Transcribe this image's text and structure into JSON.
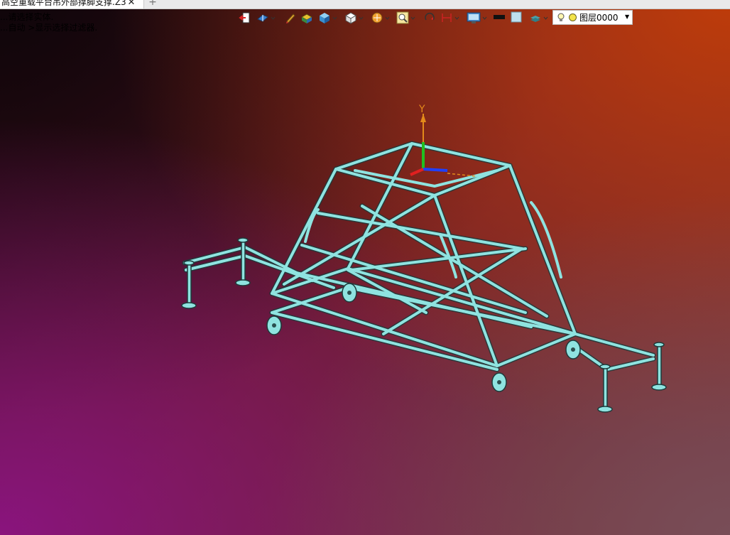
{
  "document_tab": {
    "title": "高空重载平台吊外部撑脚支撑.Z3",
    "close_symbol": "✕",
    "add_symbol": "+"
  },
  "status_lines": [
    "...请选择实体.",
    "...自动 >显示选择过滤器."
  ],
  "toolbar": {
    "icons": [
      {
        "name": "exit-icon",
        "has_dropdown": false
      },
      {
        "name": "view-orient-icon",
        "has_dropdown": true
      },
      {
        "name": "sketch-pen-icon",
        "has_dropdown": false
      },
      {
        "name": "shaded-solid-icon",
        "has_dropdown": false
      },
      {
        "name": "box-view-icon",
        "has_dropdown": true
      },
      {
        "name": "white-cube-icon",
        "has_dropdown": true
      },
      {
        "name": "render-style-icon",
        "has_dropdown": true
      },
      {
        "name": "zoom-fit-icon",
        "has_dropdown": true
      },
      {
        "name": "rotate-icon",
        "has_dropdown": false
      },
      {
        "name": "dimension-icon",
        "has_dropdown": true
      },
      {
        "name": "display-settings-icon",
        "has_dropdown": true
      },
      {
        "name": "line-color-icon",
        "has_dropdown": false
      },
      {
        "name": "fill-color-icon",
        "has_dropdown": false
      },
      {
        "name": "layer-stack-icon",
        "has_dropdown": true
      }
    ],
    "colors": {
      "line_swatch": "#111111",
      "fill_swatch": "#bfe0f0"
    }
  },
  "layer_selector": {
    "value": "图层0000",
    "bulb_icon": "lightbulb-icon",
    "dot_color": "#f2e34a"
  },
  "viewport": {
    "model_color": "#8fe3e0",
    "axis": {
      "y_label": "Y",
      "y_color": "#e38a1a",
      "x_color": "#2040ff",
      "z_color": "#e02020"
    }
  }
}
